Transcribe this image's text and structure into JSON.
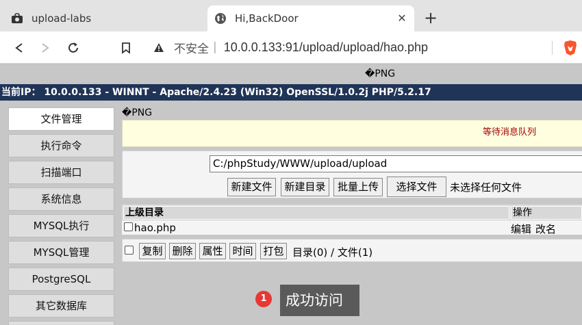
{
  "browser": {
    "tabs": [
      {
        "title": "upload-labs",
        "active": false,
        "icon": "cloud-lock-icon"
      },
      {
        "title": "Hi,BackDoor",
        "active": true,
        "icon": "globe-icon"
      }
    ],
    "new_tab_label": "+",
    "close_label": "✕",
    "address": {
      "security_label": "不安全",
      "separator": "|",
      "url": "10.0.0.133:91/upload/upload/hao.php"
    }
  },
  "page": {
    "png_top": "�PNG",
    "ip_line": "当前IP： 10.0.0.133 - WINNT - Apache/2.4.23 (Win32) OpenSSL/1.0.2j PHP/5.2.17",
    "sidebar": [
      {
        "label": "文件管理",
        "active": true
      },
      {
        "label": "执行命令",
        "active": false
      },
      {
        "label": "扫描端口",
        "active": false
      },
      {
        "label": "系统信息",
        "active": false
      },
      {
        "label": "MYSQL执行",
        "active": false
      },
      {
        "label": "MYSQL管理",
        "active": false
      },
      {
        "label": "PostgreSQL",
        "active": false
      },
      {
        "label": "其它数据库",
        "active": false
      }
    ],
    "png_main": "�PNG",
    "message_queue": "等待消息队列",
    "path_value": "C:/phpStudy/WWW/upload/upload",
    "buttons": {
      "new_file": "新建文件",
      "new_dir": "新建目录",
      "batch_upload": "批量上传",
      "choose_file": "选择文件",
      "no_file": "未选择任何文件"
    },
    "table": {
      "headers": [
        "上级目录",
        "操作"
      ],
      "rows": [
        {
          "name": "hao.php",
          "actions": [
            "编辑",
            "改名"
          ]
        }
      ]
    },
    "actions": [
      "复制",
      "删除",
      "属性",
      "时间",
      "打包"
    ],
    "counts": "目录(0) / 文件(1)",
    "tooltip": {
      "badge": "1",
      "text": "成功访问"
    }
  },
  "colors": {
    "ip_bar_bg": "#1f3457",
    "message_text": "#a00000",
    "message_bg": "#ffffe0",
    "badge_bg": "#e53935",
    "brave_orange": "#fb542b"
  }
}
